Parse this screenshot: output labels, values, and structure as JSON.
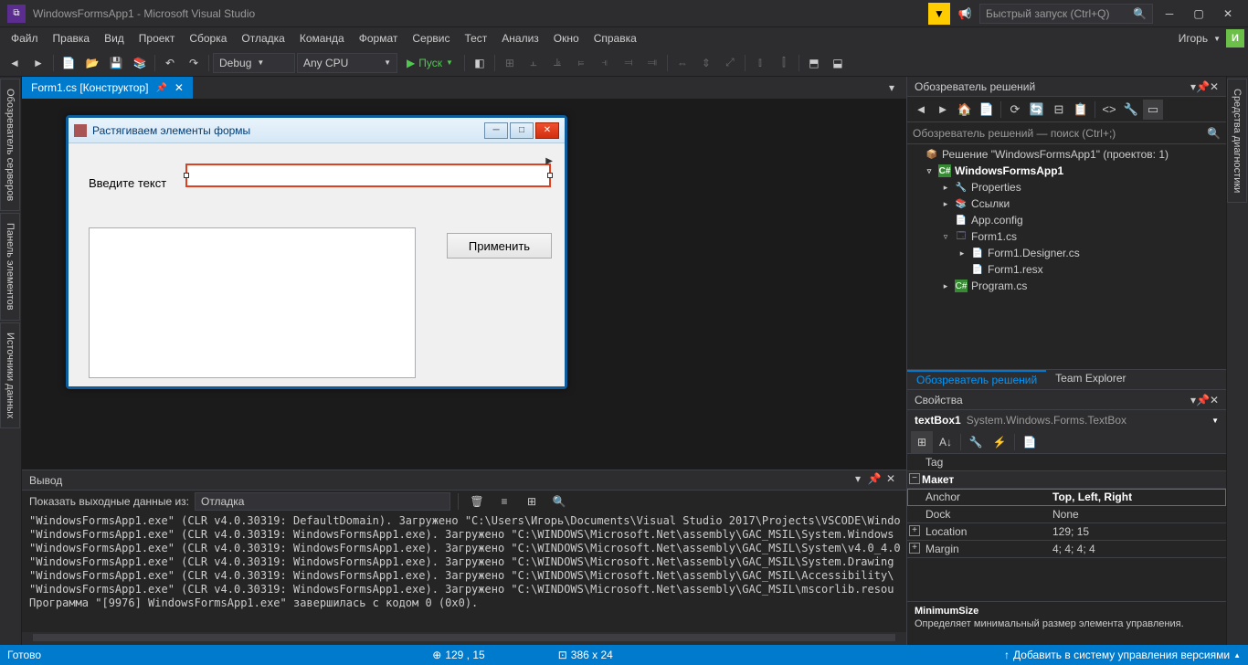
{
  "title": "WindowsFormsApp1 - Microsoft Visual Studio",
  "quick_launch_placeholder": "Быстрый запуск (Ctrl+Q)",
  "user_name": "Игорь",
  "user_initial": "И",
  "menu": [
    "Файл",
    "Правка",
    "Вид",
    "Проект",
    "Сборка",
    "Отладка",
    "Команда",
    "Формат",
    "Сервис",
    "Тест",
    "Анализ",
    "Окно",
    "Справка"
  ],
  "toolbar": {
    "config": "Debug",
    "platform": "Any CPU",
    "run_label": "Пуск"
  },
  "document_tab": "Form1.cs [Конструктор]",
  "left_rails": [
    "Обозреватель серверов",
    "Панель элементов",
    "Источники данных"
  ],
  "right_rails": [
    "Средства диагностики"
  ],
  "form": {
    "title": "Растягиваем элементы формы",
    "label": "Введите текст",
    "button": "Применить"
  },
  "output": {
    "title": "Вывод",
    "show_from_label": "Показать выходные данные из:",
    "show_from_value": "Отладка",
    "lines": [
      "\"WindowsFormsApp1.exe\" (CLR v4.0.30319: DefaultDomain). Загружено \"C:\\Users\\Игорь\\Documents\\Visual Studio 2017\\Projects\\VSCODE\\Windo",
      "\"WindowsFormsApp1.exe\" (CLR v4.0.30319: WindowsFormsApp1.exe). Загружено \"C:\\WINDOWS\\Microsoft.Net\\assembly\\GAC_MSIL\\System.Windows",
      "\"WindowsFormsApp1.exe\" (CLR v4.0.30319: WindowsFormsApp1.exe). Загружено \"C:\\WINDOWS\\Microsoft.Net\\assembly\\GAC_MSIL\\System\\v4.0_4.0",
      "\"WindowsFormsApp1.exe\" (CLR v4.0.30319: WindowsFormsApp1.exe). Загружено \"C:\\WINDOWS\\Microsoft.Net\\assembly\\GAC_MSIL\\System.Drawing",
      "\"WindowsFormsApp1.exe\" (CLR v4.0.30319: WindowsFormsApp1.exe). Загружено \"C:\\WINDOWS\\Microsoft.Net\\assembly\\GAC_MSIL\\Accessibility\\",
      "\"WindowsFormsApp1.exe\" (CLR v4.0.30319: WindowsFormsApp1.exe). Загружено \"C:\\WINDOWS\\Microsoft.Net\\assembly\\GAC_MSIL\\mscorlib.resou",
      "Программа \"[9976] WindowsFormsApp1.exe\" завершилась с кодом 0 (0x0)."
    ]
  },
  "solution_explorer": {
    "title": "Обозреватель решений",
    "search_placeholder": "Обозреватель решений — поиск (Ctrl+;)",
    "solution_label": "Решение \"WindowsFormsApp1\" (проектов: 1)",
    "project": "WindowsFormsApp1",
    "nodes": {
      "properties": "Properties",
      "references": "Ссылки",
      "appconfig": "App.config",
      "form1": "Form1.cs",
      "form1designer": "Form1.Designer.cs",
      "form1resx": "Form1.resx",
      "program": "Program.cs"
    },
    "tabs": [
      "Обозреватель решений",
      "Team Explorer"
    ]
  },
  "properties": {
    "title": "Свойства",
    "object": "textBox1",
    "type": "System.Windows.Forms.TextBox",
    "rows": [
      {
        "name": "Tag",
        "val": ""
      },
      {
        "cat": "Макет"
      },
      {
        "name": "Anchor",
        "val": "Top, Left, Right",
        "highlight": true
      },
      {
        "name": "Dock",
        "val": "None"
      },
      {
        "name": "Location",
        "val": "129; 15",
        "exp": true
      },
      {
        "name": "Margin",
        "val": "4; 4; 4; 4",
        "exp": true
      }
    ],
    "desc_name": "MinimumSize",
    "desc_text": "Определяет минимальный размер элемента управления."
  },
  "statusbar": {
    "ready": "Готово",
    "pos": "129 , 15",
    "size": "386 x 24",
    "add_source": "Добавить в систему управления версиями"
  }
}
